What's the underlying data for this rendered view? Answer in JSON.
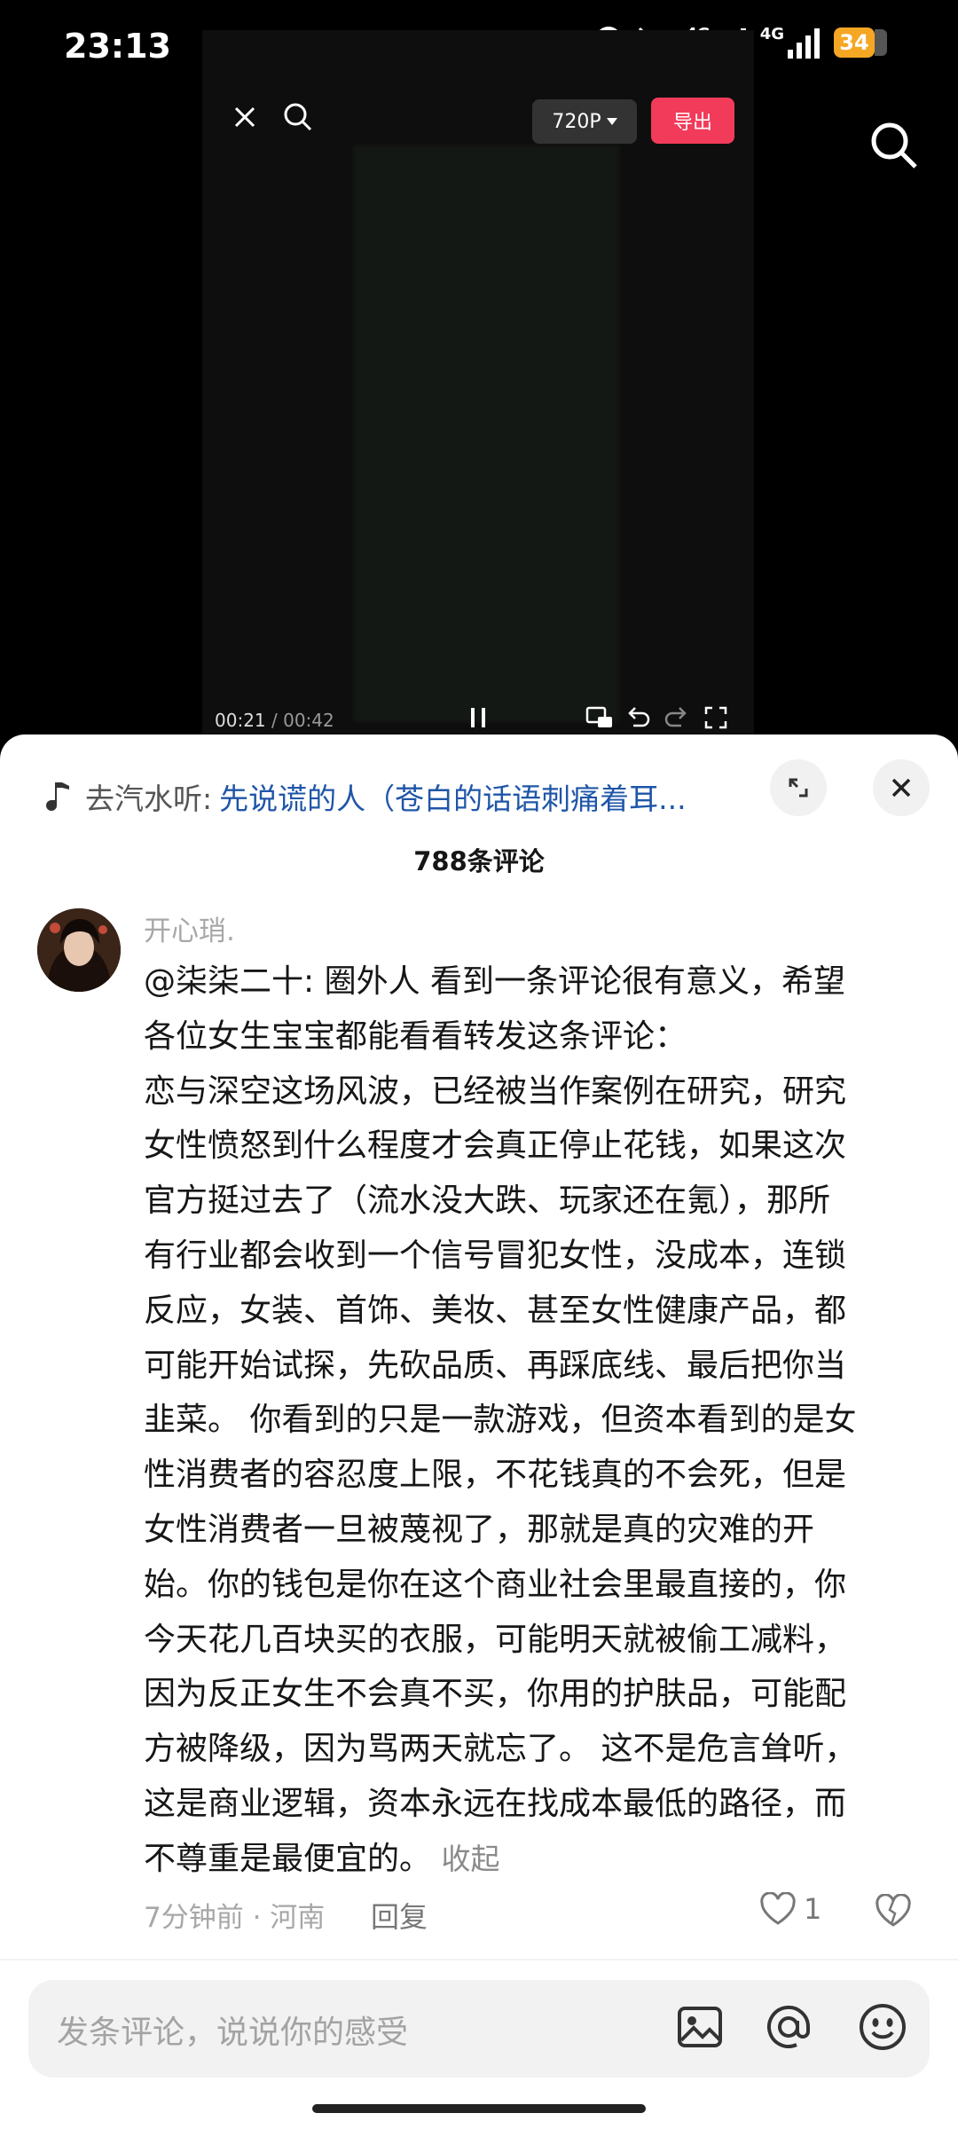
{
  "status_bar": {
    "time": "23:13",
    "network_1": "4G",
    "network_2": "4G",
    "battery": "34"
  },
  "video": {
    "resolution": "720P",
    "export_label": "导出",
    "current_time": "00:21",
    "separator": " / ",
    "total_time": "00:42"
  },
  "music": {
    "prefix": "去汽水听:",
    "song": "先说谎的人（苍白的话语刺痛着耳..."
  },
  "comments_count": "788条评论",
  "comment": {
    "author": "开心琑.",
    "text": "@柒柒二十: 圈外人 看到一条评论很有意义，希望\n各位女生宝宝都能看看转发这条评论：\n恋与深空这场风波，已经被当作案例在研究，研究\n女性愤怒到什么程度才会真正停止花钱，如果这次\n官方挺过去了（流水没大跌、玩家还在氪），那所\n有行业都会收到一个信号冒犯女性，没成本，连锁\n反应，女装、首饰、美妆、甚至女性健康产品，都\n可能开始试探，先砍品质、再踩底线、最后把你当\n韭菜。 你看到的只是一款游戏，但资本看到的是女\n性消费者的容忍度上限，不花钱真的不会死，但是\n女性消费者一旦被蔑视了，那就是真的灾难的开\n始。你的钱包是你在这个商业社会里最直接的，你\n今天花几百块买的衣服，可能明天就被偷工减料，\n因为反正女生不会真不买，你用的护肤品，可能配\n方被降级，因为骂两天就忘了。 这不是危言耸听，\n这是商业逻辑，资本永远在找成本最低的路径，而\n不尊重是最便宜的。 ",
    "collapse_label": "收起",
    "time_location": "7分钟前 · 河南",
    "reply_label": "回复",
    "like_count": "1"
  },
  "input": {
    "placeholder": "发条评论，说说你的感受"
  },
  "colors": {
    "accent_red": "#f23b5a",
    "link_blue": "#1f56a8",
    "battery_orange": "#f5a623"
  }
}
